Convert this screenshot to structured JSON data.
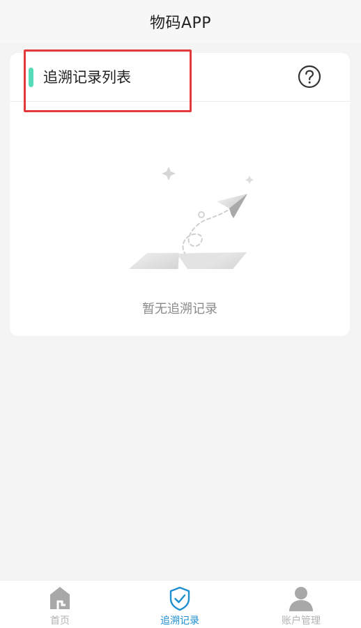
{
  "app": {
    "title": "物码APP"
  },
  "section": {
    "title": "追溯记录列表",
    "accent_color": "#56dcb8",
    "help_icon": "question-circle-icon"
  },
  "empty_state": {
    "message": "暂无追溯记录",
    "illustration": "empty-box-paper-plane"
  },
  "tabs": [
    {
      "label": "首页",
      "icon": "home-icon",
      "active": false
    },
    {
      "label": "追溯记录",
      "icon": "shield-check-icon",
      "active": true
    },
    {
      "label": "账户管理",
      "icon": "user-icon",
      "active": false
    }
  ],
  "colors": {
    "active_tab": "#1d8fd0",
    "inactive_tab": "#b3b3b3",
    "highlight_border": "#e5383b"
  }
}
